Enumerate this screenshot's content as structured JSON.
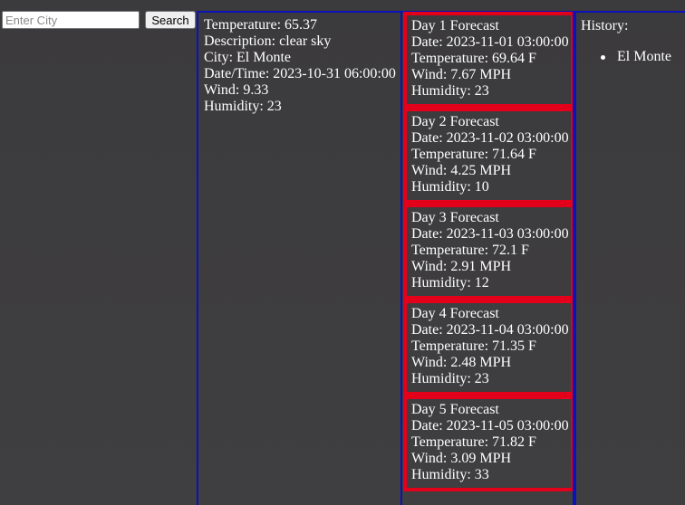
{
  "search": {
    "placeholder": "Enter City",
    "value": "",
    "button_label": "Search"
  },
  "current": {
    "temperature": "Temperature: 65.37",
    "description": "Description: clear sky",
    "city": "City: El Monte",
    "datetime": "Date/Time: 2023-10-31 06:00:00",
    "wind": "Wind: 9.33",
    "humidity": "Humidity: 23"
  },
  "forecast": [
    {
      "title": "Day 1 Forecast",
      "date": "Date: 2023-11-01 03:00:00",
      "temperature": "Temperature: 69.64 F",
      "wind": "Wind: 7.67 MPH",
      "humidity": "Humidity: 23"
    },
    {
      "title": "Day 2 Forecast",
      "date": "Date: 2023-11-02 03:00:00",
      "temperature": "Temperature: 71.64 F",
      "wind": "Wind: 4.25 MPH",
      "humidity": "Humidity: 10"
    },
    {
      "title": "Day 3 Forecast",
      "date": "Date: 2023-11-03 03:00:00",
      "temperature": "Temperature: 72.1 F",
      "wind": "Wind: 2.91 MPH",
      "humidity": "Humidity: 12"
    },
    {
      "title": "Day 4 Forecast",
      "date": "Date: 2023-11-04 03:00:00",
      "temperature": "Temperature: 71.35 F",
      "wind": "Wind: 2.48 MPH",
      "humidity": "Humidity: 23"
    },
    {
      "title": "Day 5 Forecast",
      "date": "Date: 2023-11-05 03:00:00",
      "temperature": "Temperature: 71.82 F",
      "wind": "Wind: 3.09 MPH",
      "humidity": "Humidity: 33"
    }
  ],
  "history": {
    "heading": "History:",
    "items": [
      "El Monte"
    ]
  },
  "colors": {
    "background": "#3d3c3e",
    "panel_border": "#0a12b8",
    "forecast_border": "#e3001b",
    "text": "#ffffff"
  }
}
